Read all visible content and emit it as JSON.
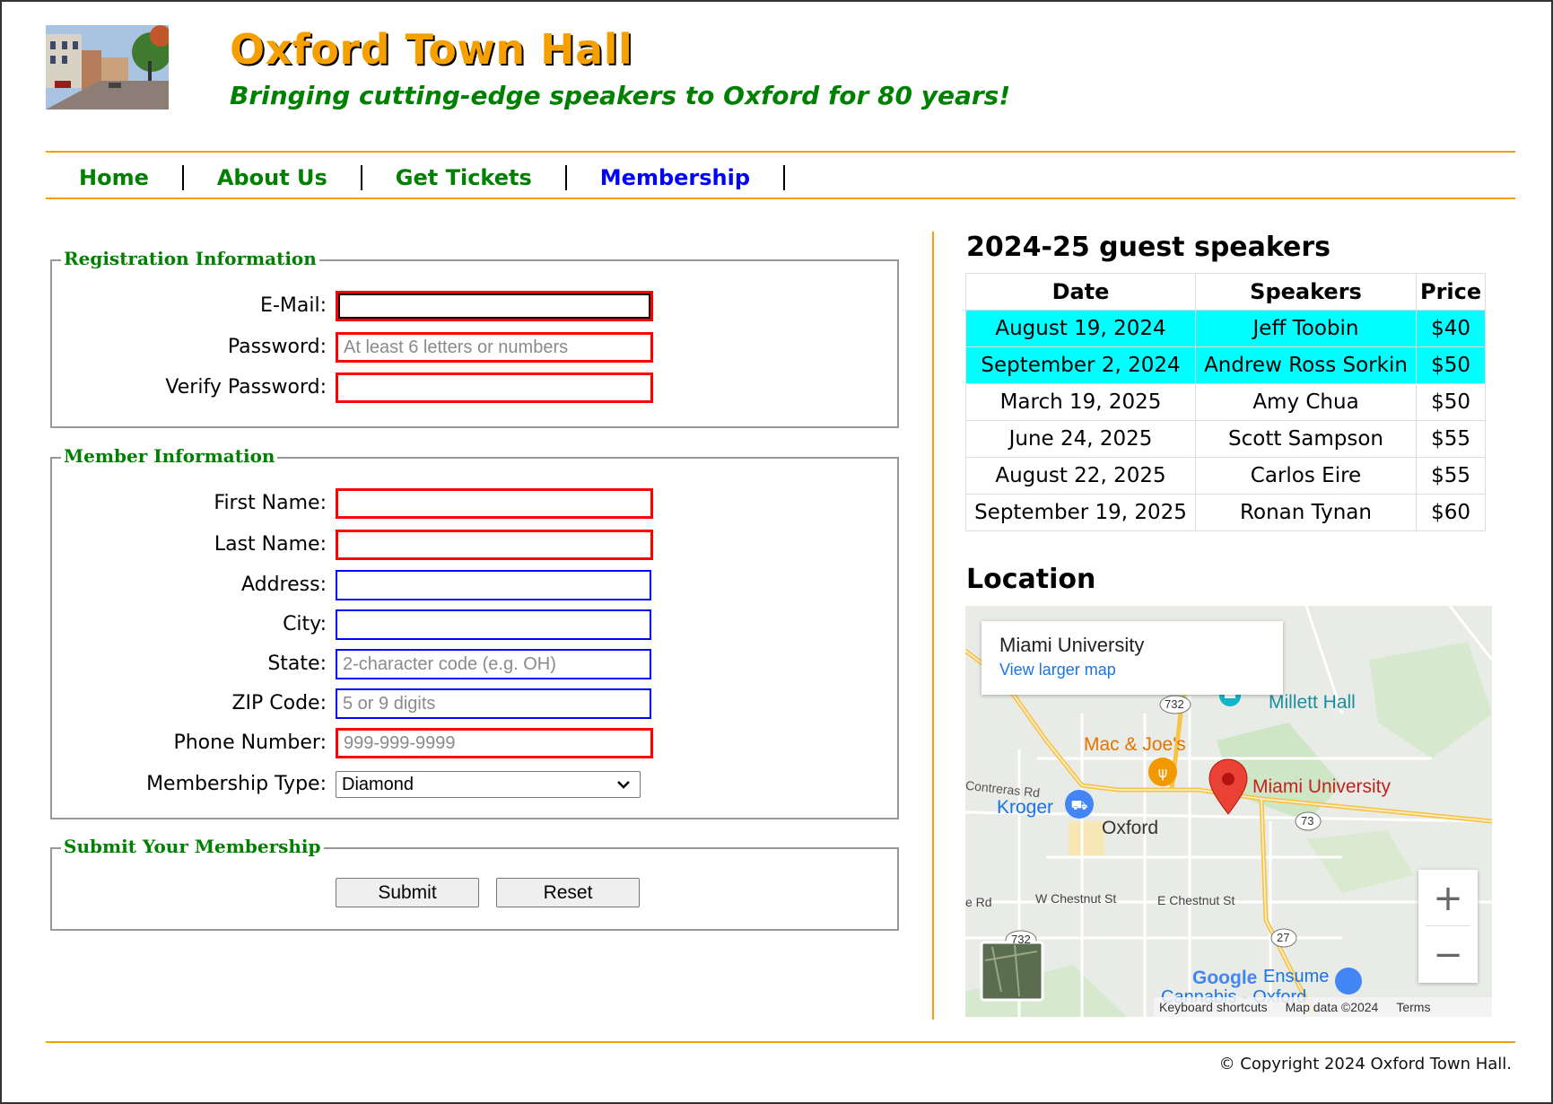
{
  "header": {
    "logo_alt": "Oxford street scene",
    "title": "Oxford Town Hall",
    "tagline": "Bringing cutting-edge speakers to Oxford for 80 years!"
  },
  "nav": {
    "items": [
      {
        "label": "Home"
      },
      {
        "label": "About Us"
      },
      {
        "label": "Get Tickets"
      },
      {
        "label": "Membership"
      }
    ],
    "active": "Membership"
  },
  "registration": {
    "legend": "Registration Information",
    "email": {
      "label": "E-Mail:",
      "value": "",
      "placeholder": ""
    },
    "password": {
      "label": "Password:",
      "value": "",
      "placeholder": "At least 6 letters or numbers"
    },
    "verify": {
      "label": "Verify Password:",
      "value": "",
      "placeholder": ""
    }
  },
  "member": {
    "legend": "Member Information",
    "first_name": {
      "label": "First Name:",
      "value": "",
      "placeholder": ""
    },
    "last_name": {
      "label": "Last Name:",
      "value": "",
      "placeholder": ""
    },
    "address": {
      "label": "Address:",
      "value": "",
      "placeholder": ""
    },
    "city": {
      "label": "City:",
      "value": "",
      "placeholder": ""
    },
    "state": {
      "label": "State:",
      "value": "",
      "placeholder": "2-character code (e.g. OH)"
    },
    "zip": {
      "label": "ZIP Code:",
      "value": "",
      "placeholder": "5 or 9 digits"
    },
    "phone": {
      "label": "Phone Number:",
      "value": "",
      "placeholder": "999-999-9999"
    },
    "membership_type": {
      "label": "Membership Type:",
      "selected": "Diamond"
    }
  },
  "submit_section": {
    "legend": "Submit Your Membership",
    "submit_label": "Submit",
    "reset_label": "Reset"
  },
  "speakers": {
    "heading": "2024-25 guest speakers",
    "columns": [
      "Date",
      "Speakers",
      "Price"
    ],
    "rows": [
      {
        "date": "August 19, 2024",
        "speaker": "Jeff Toobin",
        "price": "$40",
        "highlight": true
      },
      {
        "date": "September 2, 2024",
        "speaker": "Andrew Ross Sorkin",
        "price": "$50",
        "highlight": true
      },
      {
        "date": "March 19, 2025",
        "speaker": "Amy Chua",
        "price": "$50",
        "highlight": false
      },
      {
        "date": "June 24, 2025",
        "speaker": "Scott Sampson",
        "price": "$55",
        "highlight": false
      },
      {
        "date": "August 22, 2025",
        "speaker": "Carlos Eire",
        "price": "$55",
        "highlight": false
      },
      {
        "date": "September 19, 2025",
        "speaker": "Ronan Tynan",
        "price": "$60",
        "highlight": false
      }
    ],
    "highlight_color": "#00ffff"
  },
  "location": {
    "heading": "Location",
    "map": {
      "card_title": "Miami University",
      "card_link": "View larger map",
      "labels": {
        "millett": "Millett Hall",
        "macjoes": "Mac & Joe's",
        "miami": "Miami University",
        "contreras": "Contreras Rd",
        "kroger": "Kroger",
        "oxford": "Oxford",
        "wchestnut": "W Chestnut St",
        "echestnut": "E Chestnut St",
        "rd": "e Rd",
        "r732": "732",
        "r732b": "732",
        "r73": "73",
        "r27": "27",
        "ensume": "Ensume",
        "cannabis": "Cannabis - Oxford",
        "google": "Google"
      },
      "zoom_in": "+",
      "zoom_out": "−",
      "footer": [
        "Keyboard shortcuts",
        "Map data ©2024",
        "Terms"
      ]
    }
  },
  "footer": {
    "copyright": "© Copyright 2024 Oxford Town Hall."
  },
  "colors": {
    "accent": "#f5a000",
    "green": "#008000",
    "nav_active": "#0000ff",
    "required_border": "#ff0000",
    "optional_border": "#0000ff"
  }
}
